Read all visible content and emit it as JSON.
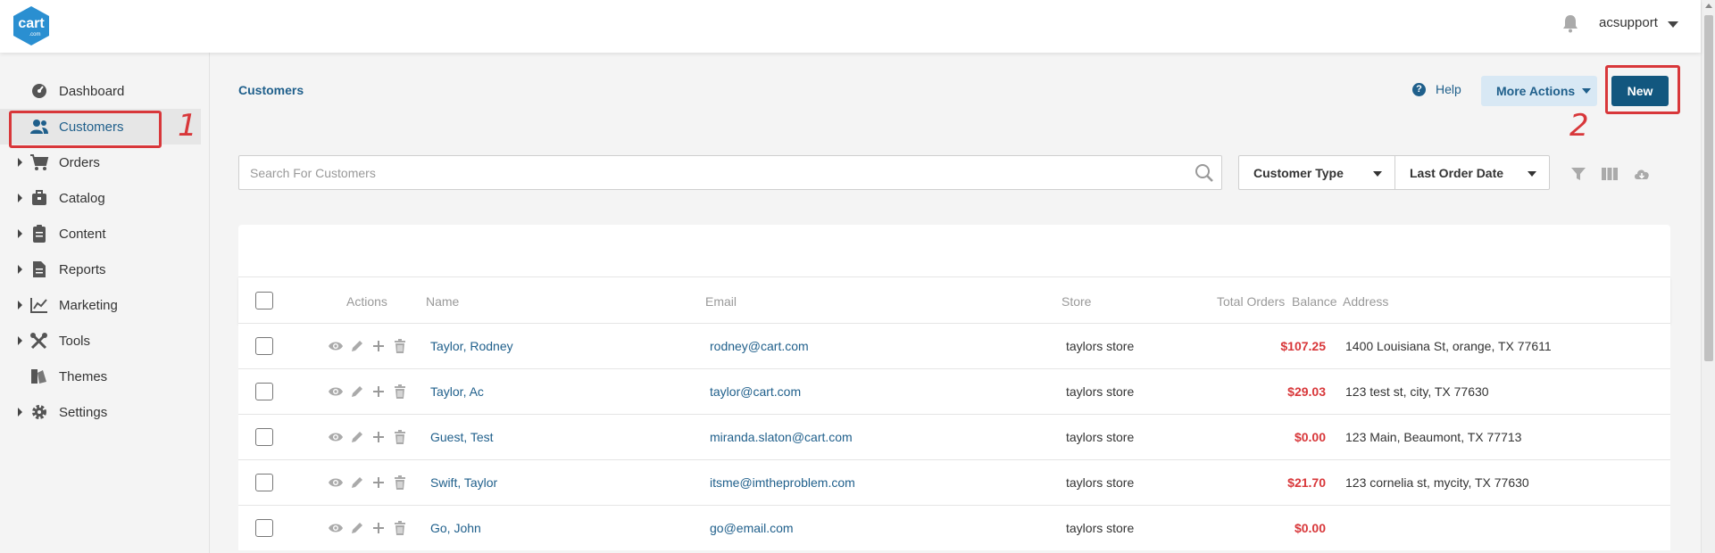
{
  "header": {
    "logo_text": "cart",
    "logo_subtext": ".com",
    "username": "acsupport"
  },
  "sidebar": {
    "items": [
      {
        "label": "Dashboard",
        "icon": "dashboard-icon",
        "expandable": false
      },
      {
        "label": "Customers",
        "icon": "customers-icon",
        "expandable": false,
        "active": true
      },
      {
        "label": "Orders",
        "icon": "cart-icon",
        "expandable": true
      },
      {
        "label": "Catalog",
        "icon": "catalog-icon",
        "expandable": true
      },
      {
        "label": "Content",
        "icon": "clipboard-icon",
        "expandable": true
      },
      {
        "label": "Reports",
        "icon": "report-icon",
        "expandable": true
      },
      {
        "label": "Marketing",
        "icon": "chart-icon",
        "expandable": true
      },
      {
        "label": "Tools",
        "icon": "tools-icon",
        "expandable": true
      },
      {
        "label": "Themes",
        "icon": "themes-icon",
        "expandable": false
      },
      {
        "label": "Settings",
        "icon": "gear-icon",
        "expandable": true
      }
    ]
  },
  "page": {
    "breadcrumb": "Customers",
    "help_label": "Help",
    "more_actions_label": "More Actions",
    "new_label": "New"
  },
  "annotations": {
    "marker_1": "1",
    "marker_2": "2"
  },
  "search": {
    "placeholder": "Search For Customers",
    "value": ""
  },
  "filters": {
    "customer_type": "Customer Type",
    "last_order_date": "Last Order Date"
  },
  "table": {
    "columns": {
      "actions": "Actions",
      "name": "Name",
      "email": "Email",
      "store": "Store",
      "total_orders": "Total Orders",
      "balance": "Balance",
      "address": "Address"
    },
    "rows": [
      {
        "name": "Taylor, Rodney",
        "email": "rodney@cart.com",
        "store": "taylors store",
        "balance": "$107.25",
        "address": "1400 Louisiana St, orange, TX 77611"
      },
      {
        "name": "Taylor, Ac",
        "email": "taylor@cart.com",
        "store": "taylors store",
        "balance": "$29.03",
        "address": "123 test st, city, TX 77630"
      },
      {
        "name": "Guest, Test",
        "email": "miranda.slaton@cart.com",
        "store": "taylors store",
        "balance": "$0.00",
        "address": "123 Main, Beaumont, TX 77713"
      },
      {
        "name": "Swift, Taylor",
        "email": "itsme@imtheproblem.com",
        "store": "taylors store",
        "balance": "$21.70",
        "address": "123 cornelia st, mycity, TX 77630"
      },
      {
        "name": "Go, John",
        "email": "go@email.com",
        "store": "taylors store",
        "balance": "$0.00",
        "address": ""
      }
    ]
  },
  "colors": {
    "accent": "#1f5f8b",
    "primary_button": "#12577f",
    "annotation": "#d8373a",
    "money": "#d8373a"
  }
}
